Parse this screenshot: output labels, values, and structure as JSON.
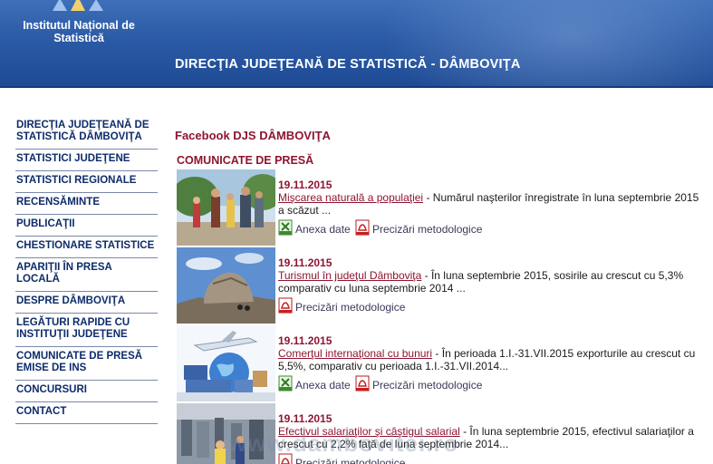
{
  "header": {
    "institute_name": "Institutul Național de Statistică",
    "title": "DIRECŢIA JUDEŢEANĂ DE STATISTICĂ - DÂMBOVIŢA"
  },
  "sidebar": {
    "items": [
      {
        "label": "DIRECŢIA JUDEŢEANĂ DE STATISTICĂ DÂMBOVIŢA"
      },
      {
        "label": "STATISTICI JUDEŢENE"
      },
      {
        "label": "STATISTICI REGIONALE"
      },
      {
        "label": "RECENSĂMINTE"
      },
      {
        "label": "PUBLICAŢII"
      },
      {
        "label": "CHESTIONARE STATISTICE"
      },
      {
        "label": "APARIŢII ÎN PRESA LOCALĂ"
      },
      {
        "label": "DESPRE DÂMBOVIŢA"
      },
      {
        "label": "LEGĂTURI RAPIDE CU INSTITUŢII JUDEŢENE"
      },
      {
        "label": "COMUNICATE DE PRESĂ EMISE DE INS"
      },
      {
        "label": "CONCURSURI"
      },
      {
        "label": "CONTACT"
      }
    ]
  },
  "main": {
    "facebook_link": "Facebook  DJS DÂMBOVIŢA",
    "section_title": "COMUNICATE DE PRESĂ",
    "news": [
      {
        "date": "19.11.2015",
        "link": "Mişcarea naturală a populaţiei",
        "text": " - Numărul naşterilor înregistrate în luna septembrie 2015 a scăzut ...",
        "annex_label": "Anexa date",
        "method_label": "Precizări metodologice"
      },
      {
        "date": "19.11.2015",
        "link": "Turismul în judeţul Dâmboviţa",
        "text": " - În luna septembrie 2015, sosirile au crescut cu 5,3% comparativ cu luna septembrie 2014 ...",
        "method_label": "Precizări metodologice"
      },
      {
        "date": "19.11.2015",
        "link": "Comerţul internaţional cu bunuri",
        "text": " - În perioada 1.I.-31.VII.2015 exporturile au crescut cu 5,5%,  comparativ cu perioada 1.I.-31.VII.2014...",
        "annex_label": "Anexa date",
        "method_label": "Precizări metodologice"
      },
      {
        "date": "19.11.2015",
        "link": "Efectivul salariaţilor şi câştigul salarial",
        "text": " - În luna septembrie 2015, efectivul salariaţilor a crescut cu 2,2% faţă de luna septembrie 2014...",
        "method_label": "Precizări metodologice"
      }
    ]
  },
  "watermark": "www.dambovitei.ro",
  "colors": {
    "header_blue": "#2b5aa6",
    "accent_red": "#8e1530",
    "nav_text": "#0e2c6a"
  }
}
